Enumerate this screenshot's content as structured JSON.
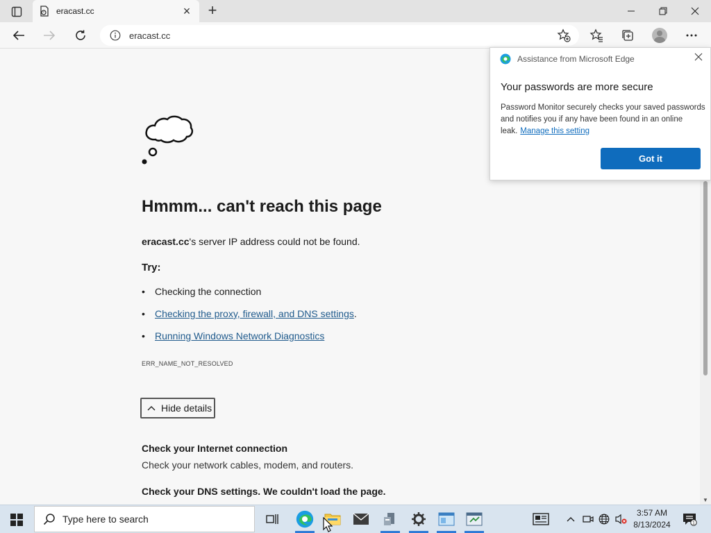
{
  "browser": {
    "tab": {
      "title": "eracast.cc"
    },
    "address": {
      "url": "eracast.cc"
    }
  },
  "error_page": {
    "title": "Hmmm... can't reach this page",
    "domain": "eracast.cc",
    "message_suffix": "'s server IP address could not be found.",
    "try_label": "Try:",
    "suggestions": [
      {
        "text": "Checking the connection",
        "link": false
      },
      {
        "text": "Checking the proxy, firewall, and DNS settings",
        "suffix": ".",
        "link": true
      },
      {
        "text": "Running Windows Network Diagnostics",
        "link": true
      }
    ],
    "error_code": "ERR_NAME_NOT_RESOLVED",
    "hide_details_label": "Hide details",
    "details": [
      {
        "heading": "Check your Internet connection",
        "body": "Check your network cables, modem, and routers."
      },
      {
        "heading": "Check your DNS settings. We couldn't load the page.",
        "body": ""
      }
    ]
  },
  "popup": {
    "header": "Assistance from Microsoft Edge",
    "title": "Your passwords are more secure",
    "body": "Password Monitor securely checks your saved passwords and notifies you if any have been found in an online leak.",
    "link": "Manage this setting",
    "button": "Got it"
  },
  "taskbar": {
    "search_placeholder": "Type here to search",
    "time": "3:57 AM",
    "date": "8/13/2024",
    "notification_count": "1"
  },
  "colors": {
    "accent": "#0f6cbd",
    "link": "#1f5a8c",
    "taskbar": "#d9e4ef",
    "page_bg": "#f7f7f7"
  }
}
